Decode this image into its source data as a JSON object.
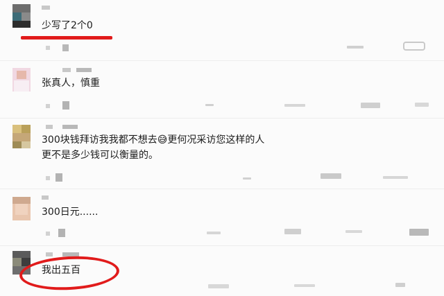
{
  "comments": [
    {
      "text": "少写了2个0"
    },
    {
      "text": "张真人，慎重"
    },
    {
      "line1": "300块钱拜访我我都不想去😅更何况采访您这样的人",
      "line2": "更不是多少钱可以衡量的。"
    },
    {
      "text": "300日元......"
    },
    {
      "text": "我出五百"
    }
  ],
  "annotations": {
    "underline_color": "#e11b1b",
    "circle_color": "#e11b1b"
  }
}
